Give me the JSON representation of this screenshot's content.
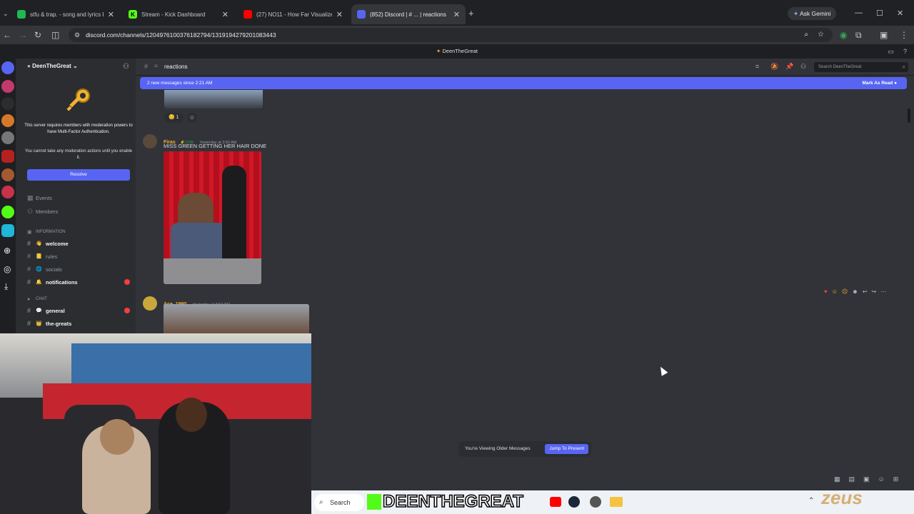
{
  "browser": {
    "tabs": [
      {
        "label": "stfu & trap. - song and lyrics by",
        "fav_color": "#1db954",
        "fav": ""
      },
      {
        "label": "Stream - Kick Dashboard",
        "fav_color": "#53fc18",
        "fav": "K"
      },
      {
        "label": "(27) NO11 - How Far Visualize",
        "fav_color": "#ff0000",
        "fav": ""
      },
      {
        "label": "(852) Discord | # ... | reactions",
        "fav_color": "#5865f2",
        "fav": ""
      }
    ],
    "new_tab": "+",
    "ask_gemini": "Ask Gemini",
    "url": "discord.com/channels/1204976100376182794/1319194279201083443"
  },
  "discord": {
    "window_title": "DeenTheGreat",
    "server_name": "DeenTheGreat",
    "mfa_notice": "This server requires members with moderation powers to have Multi-Factor Authentication.",
    "mfa_sub": "You cannot take any moderation actions until you enable it.",
    "resolve_label": "Resolve",
    "sidebar_links": [
      "Events",
      "Members"
    ],
    "category_info": "INFORMATION",
    "category_chat": "CHAT",
    "channels_info": [
      {
        "name": "welcome",
        "emoji": "👋",
        "unread": true
      },
      {
        "name": "rules",
        "emoji": "📒",
        "unread": false
      },
      {
        "name": "socials",
        "emoji": "🌐",
        "unread": false
      },
      {
        "name": "notifications",
        "emoji": "🔔",
        "unread": true
      }
    ],
    "channels_chat": [
      {
        "name": "general",
        "emoji": "💬",
        "unread": true
      },
      {
        "name": "the-greats",
        "emoji": "👑",
        "unread": true
      }
    ],
    "channel_name": "reactions",
    "search_placeholder": "Search DeenTheGreat",
    "new_messages": "2 new messages since 2:21 AM",
    "mark_read": "Mark As Read",
    "reaction_count": "1",
    "messages": [
      {
        "author": "Firas",
        "tag": "COB",
        "time": "Yesterday at 3:50 AM",
        "text": "MISS GREEN GETTING HER HAIR DONE",
        "color": "#f0b232"
      },
      {
        "author": "Ace_1990",
        "tag": "",
        "time": "Yesterday at 3:54 AM",
        "text": "",
        "color": "#f0b232"
      }
    ],
    "older_notice": "You're Viewing Older Messages",
    "jump_label": "Jump To Present"
  },
  "taskbar": {
    "search": "Search"
  },
  "overlay": {
    "streamer": "DEENTHEGREAT",
    "brand": "zeus"
  }
}
